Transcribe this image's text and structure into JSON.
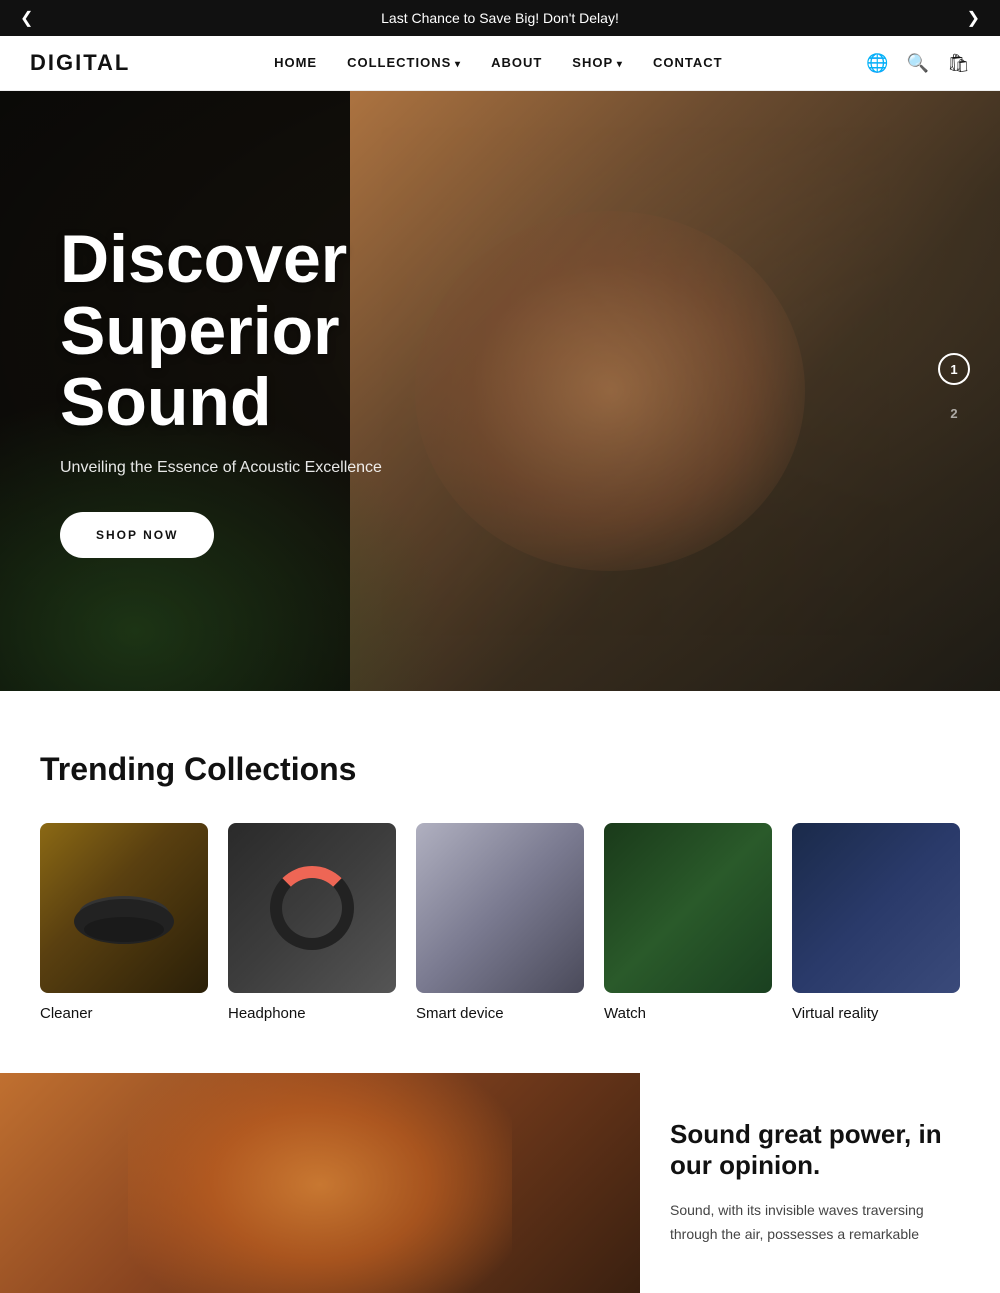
{
  "announcement": {
    "text": "Last Chance to Save Big! Don't Delay!",
    "prev_arrow": "❮",
    "next_arrow": "❯"
  },
  "header": {
    "logo": "DIGITAL",
    "nav": [
      {
        "label": "HOME",
        "dropdown": false
      },
      {
        "label": "COLLECTIONS",
        "dropdown": true
      },
      {
        "label": "ABOUT",
        "dropdown": false
      },
      {
        "label": "SHOP",
        "dropdown": true
      },
      {
        "label": "CONTACT",
        "dropdown": false
      }
    ],
    "icons": {
      "globe": "🌐",
      "search": "🔍",
      "cart": "🛍"
    }
  },
  "hero": {
    "title_line1": "Discover",
    "title_line2": "Superior Sound",
    "subtitle": "Unveiling the Essence of Acoustic Excellence",
    "cta_label": "SHOP NOW",
    "pagination": [
      {
        "number": "1",
        "active": true
      },
      {
        "number": "2",
        "active": false
      }
    ]
  },
  "trending": {
    "section_title": "Trending Collections",
    "items": [
      {
        "label": "Cleaner",
        "img_class": "img-cleaner"
      },
      {
        "label": "Headphone",
        "img_class": "img-headphone"
      },
      {
        "label": "Smart device",
        "img_class": "img-smart"
      },
      {
        "label": "Watch",
        "img_class": "img-watch"
      },
      {
        "label": "Virtual reality",
        "img_class": "img-vr"
      }
    ]
  },
  "sound_section": {
    "title": "Sound great power, in our opinion.",
    "description": "Sound, with its invisible waves traversing through the air, possesses a remarkable"
  }
}
